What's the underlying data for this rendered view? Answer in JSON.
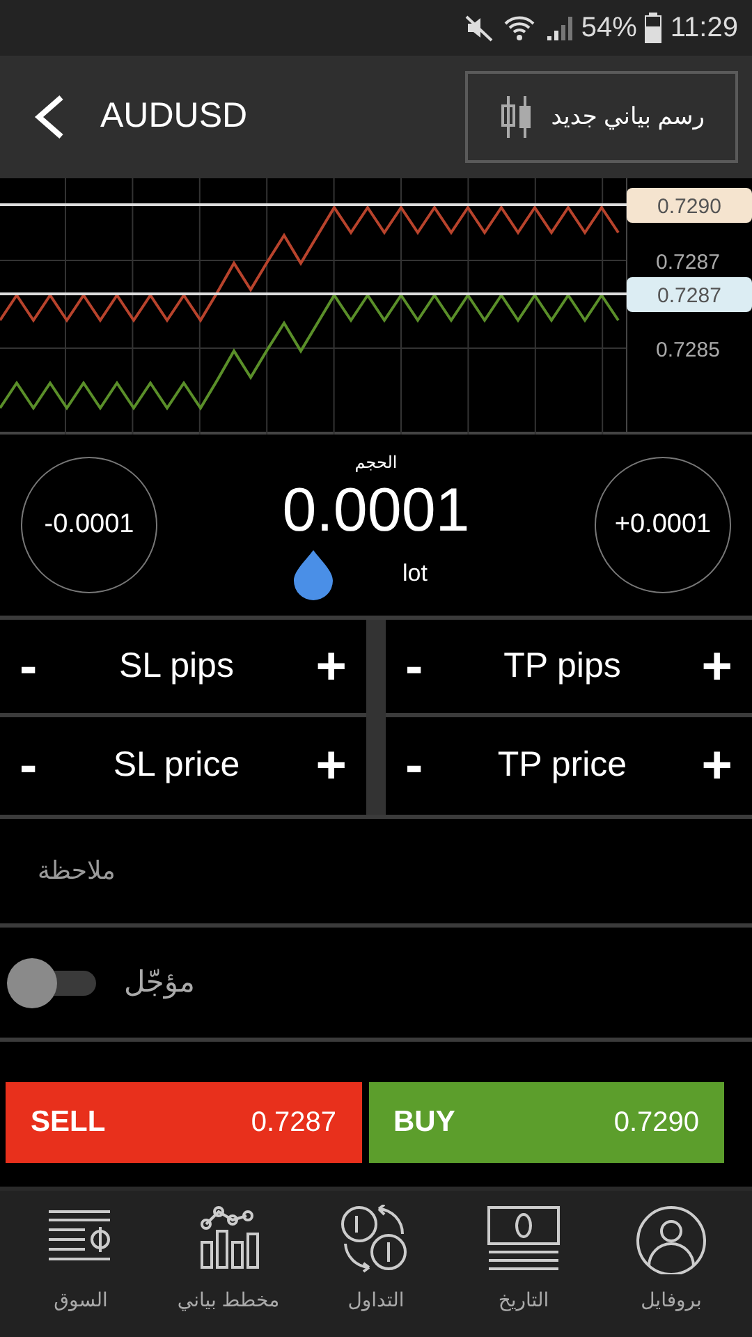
{
  "status_bar": {
    "battery": "54%",
    "time": "11:29"
  },
  "app_bar": {
    "title": "AUDUSD",
    "new_chart_button": "رسم بياني جديد"
  },
  "chart": {
    "axis_labels": [
      "0.7287",
      "0.7285"
    ],
    "price_tags": [
      {
        "kind": "ask",
        "label": "0.7290"
      },
      {
        "kind": "bid",
        "label": "0.7287"
      }
    ]
  },
  "volume": {
    "label": "الحجم",
    "value": "0.0001",
    "unit": "lot",
    "decrease": "-0.0001",
    "increase": "+0.0001"
  },
  "steppers": [
    {
      "minus": "-",
      "label": "TP pips",
      "plus": "+"
    },
    {
      "minus": "-",
      "label": "SL pips",
      "plus": "+"
    },
    {
      "minus": "-",
      "label": "TP price",
      "plus": "+"
    },
    {
      "minus": "-",
      "label": "SL price",
      "plus": "+"
    }
  ],
  "note": {
    "placeholder": "ملاحظة"
  },
  "pending": {
    "label": "مؤجّل",
    "on": false
  },
  "trade_buttons": [
    {
      "kind": "buy",
      "label": "BUY",
      "price": "0.7290"
    },
    {
      "kind": "sell",
      "label": "SELL",
      "price": "0.7287"
    }
  ],
  "bottom_nav": [
    {
      "kind": "profile",
      "label": "بروفايل"
    },
    {
      "kind": "history",
      "label": "التاريخ"
    },
    {
      "kind": "trade",
      "label": "التداول"
    },
    {
      "kind": "chart",
      "label": "مخطط بياني"
    },
    {
      "kind": "market",
      "label": "السوق"
    }
  ]
}
